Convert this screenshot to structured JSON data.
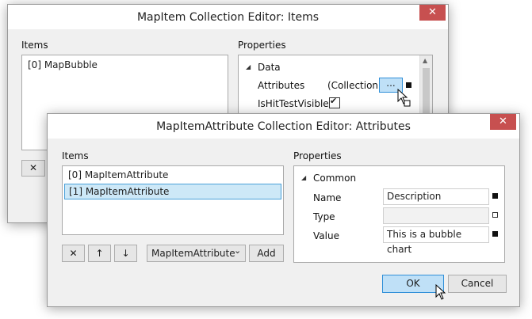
{
  "outer": {
    "title": "MapItem Collection Editor: Items",
    "close": "✕",
    "items_label": "Items",
    "properties_label": "Properties",
    "items": [
      "[0] MapBubble"
    ],
    "remove_glyph": "✕",
    "category": "Data",
    "attributes_label": "Attributes",
    "attributes_value": "(Collection)",
    "ellipsis": "...",
    "ishittest_label": "IsHitTestVisible",
    "check_glyph": "✔"
  },
  "inner": {
    "title": "MapItemAttribute Collection Editor: Attributes",
    "close": "✕",
    "items_label": "Items",
    "properties_label": "Properties",
    "items": [
      "[0] MapItemAttribute",
      "[1] MapItemAttribute"
    ],
    "selected_index": 1,
    "remove_glyph": "✕",
    "up_glyph": "↑",
    "down_glyph": "↓",
    "type_select": "MapItemAttribute",
    "select_arrow": "⌄",
    "add_label": "Add",
    "category": "Common",
    "name_label": "Name",
    "name_value": "Description",
    "type_label": "Type",
    "type_value": "",
    "value_label": "Value",
    "value_value": "This is a bubble chart",
    "ok_label": "OK",
    "cancel_label": "Cancel"
  }
}
